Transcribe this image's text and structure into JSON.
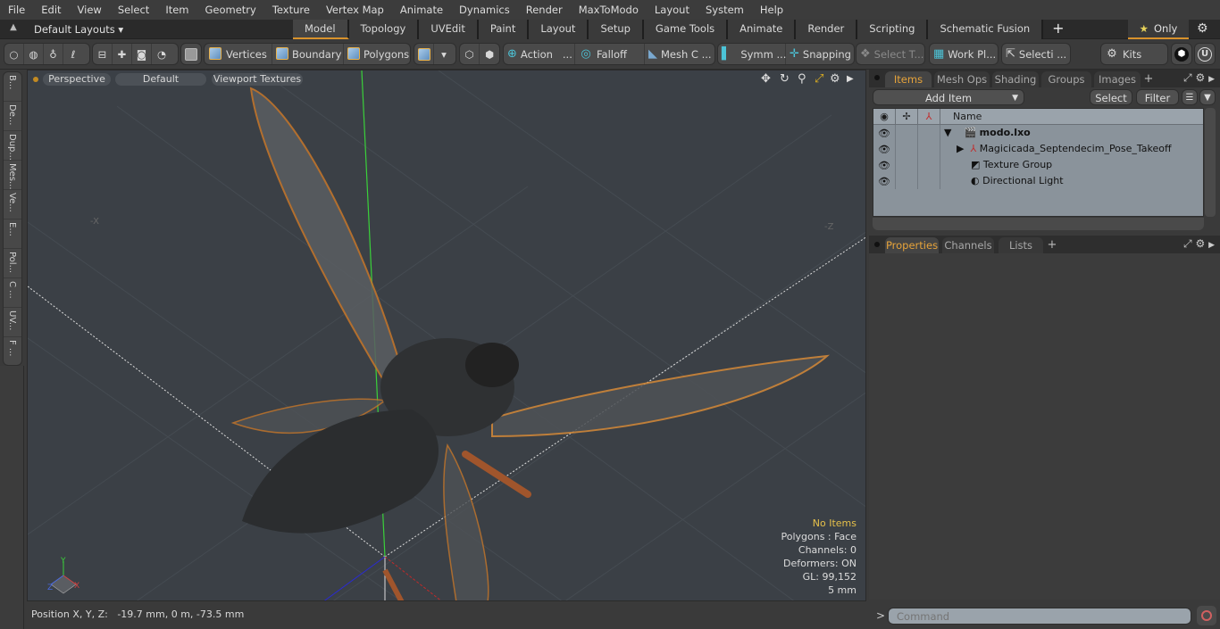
{
  "menu": [
    "File",
    "Edit",
    "View",
    "Select",
    "Item",
    "Geometry",
    "Texture",
    "Vertex Map",
    "Animate",
    "Dynamics",
    "Render",
    "MaxToModo",
    "Layout",
    "System",
    "Help"
  ],
  "layoutbar": {
    "layouts_label": "Default Layouts",
    "tabs": [
      "Model",
      "Topology",
      "UVEdit",
      "Paint",
      "Layout",
      "Setup",
      "Game Tools",
      "Animate",
      "Render",
      "Scripting",
      "Schematic Fusion"
    ],
    "active_tab": "Model",
    "only_label": "Only"
  },
  "toolbar": {
    "vertices": "Vertices",
    "boundary": "Boundary",
    "polygons": "Polygons",
    "action": "Action",
    "action_more": "...",
    "falloff": "Falloff",
    "mesh": "Mesh C ...",
    "symm": "Symm ...",
    "snapping": "Snapping",
    "select_t": "Select T...",
    "work_pl": "Work Pl...",
    "selecti": "Selecti ...",
    "kits": "Kits"
  },
  "sidetabs": [
    "B...",
    "De...",
    "Dup...",
    "Mes...",
    "Ve...",
    "E...",
    "Pol...",
    "C ...",
    "UV...",
    "F ..."
  ],
  "viewport": {
    "view_mode": "Perspective",
    "shading": "Default",
    "textures": "Viewport Textures",
    "axis_x_label": "-X",
    "axis_z_label": "-Z",
    "stats": {
      "selection": "No Items",
      "polygons": "Polygons : Face",
      "channels": "Channels: 0",
      "deformers": "Deformers: ON",
      "gl": "GL: 99,152",
      "grid": "5 mm"
    },
    "gizmo": {
      "x": "X",
      "y": "Y",
      "z": "Z"
    }
  },
  "items_panel": {
    "tabs": [
      "Items",
      "Mesh Ops",
      "Shading",
      "Groups",
      "Images"
    ],
    "active_tab": "Items",
    "add_item": "Add Item",
    "select": "Select",
    "filter": "Filter",
    "column_name": "Name",
    "rows": [
      {
        "name": "modo.lxo",
        "bold": true
      },
      {
        "name": "Magicicada_Septendecim_Pose_Takeoff"
      },
      {
        "name": "Texture Group"
      },
      {
        "name": "Directional Light"
      }
    ]
  },
  "properties_panel": {
    "tabs": [
      "Properties",
      "Channels",
      "Lists"
    ],
    "active_tab": "Properties"
  },
  "statusbar": {
    "position_label": "Position X, Y, Z:",
    "position_value": "-19.7 mm, 0 m, -73.5 mm"
  },
  "command": {
    "placeholder": "Command",
    "prompt": ">"
  },
  "colors": {
    "accent": "#d8922c",
    "active_tab_text": "#e6a33a",
    "no_items": "#e6c04a"
  }
}
